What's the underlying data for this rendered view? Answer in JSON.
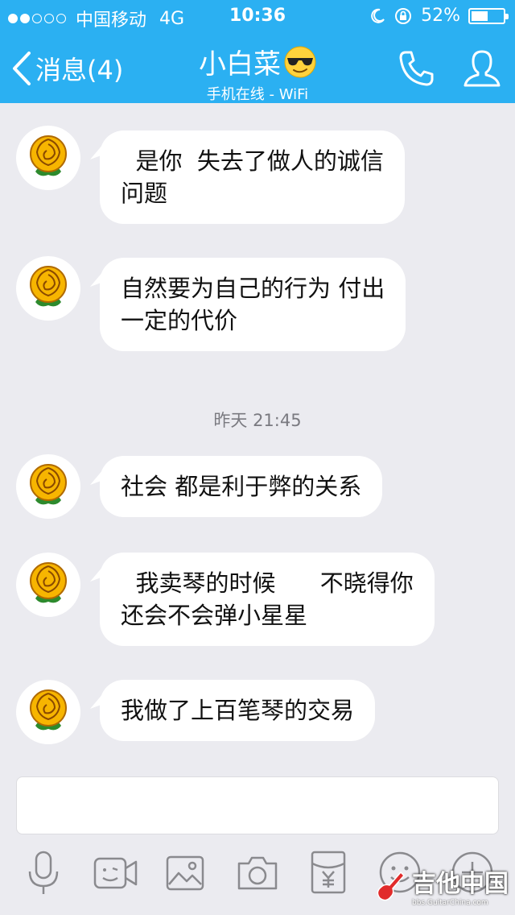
{
  "status_bar": {
    "carrier": "中国移动",
    "network": "4G",
    "time": "10:36",
    "battery": "52%",
    "battery_level": 0.52
  },
  "nav": {
    "back_label": "消息(4)",
    "title": "小白菜",
    "subtitle": "手机在线 - WiFi"
  },
  "messages": [
    {
      "text": "  是你  失去了做人的诚信\n问题"
    },
    {
      "text": "自然要为自己的行为 付出\n一定的代价"
    },
    {
      "text": "社会 都是利于弊的关系"
    },
    {
      "text": "  我卖琴的时候      不晓得你\n还会不会弹小星星"
    },
    {
      "text": "我做了上百笔琴的交易"
    }
  ],
  "timestamp": "昨天 21:45",
  "toolbar": {
    "icons": [
      "microphone-icon",
      "video-icon",
      "image-icon",
      "camera-icon",
      "red-packet-icon",
      "emoji-icon",
      "plus-icon"
    ]
  },
  "watermark": {
    "title": "吉他中国",
    "url": "bbs.GuitarChina.com"
  },
  "colors": {
    "accent": "#2bb0f2",
    "background": "#ebebf0",
    "bubble": "#ffffff"
  }
}
